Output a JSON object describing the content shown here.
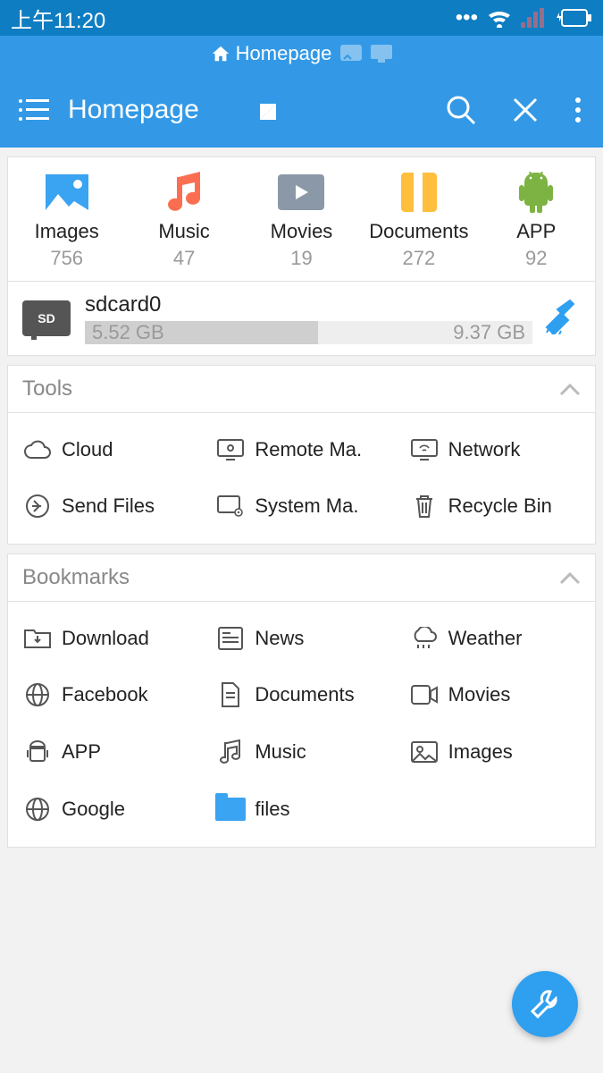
{
  "status": {
    "time": "上午11:20"
  },
  "tabs": {
    "home_label": "Homepage"
  },
  "toolbar": {
    "title": "Homepage"
  },
  "categories": [
    {
      "label": "Images",
      "count": "756"
    },
    {
      "label": "Music",
      "count": "47"
    },
    {
      "label": "Movies",
      "count": "19"
    },
    {
      "label": "Documents",
      "count": "272"
    },
    {
      "label": "APP",
      "count": "92"
    }
  ],
  "storage": {
    "name": "sdcard0",
    "used": "5.52 GB",
    "total": "9.37 GB"
  },
  "sections": {
    "tools_header": "Tools",
    "bookmarks_header": "Bookmarks"
  },
  "tools": [
    {
      "label": "Cloud"
    },
    {
      "label": "Remote Ma."
    },
    {
      "label": "Network"
    },
    {
      "label": "Send Files"
    },
    {
      "label": "System Ma."
    },
    {
      "label": "Recycle Bin"
    }
  ],
  "bookmarks": [
    {
      "label": "Download"
    },
    {
      "label": "News"
    },
    {
      "label": "Weather"
    },
    {
      "label": "Facebook"
    },
    {
      "label": "Documents"
    },
    {
      "label": "Movies"
    },
    {
      "label": "APP"
    },
    {
      "label": "Music"
    },
    {
      "label": "Images"
    },
    {
      "label": "Google"
    },
    {
      "label": "files"
    }
  ]
}
